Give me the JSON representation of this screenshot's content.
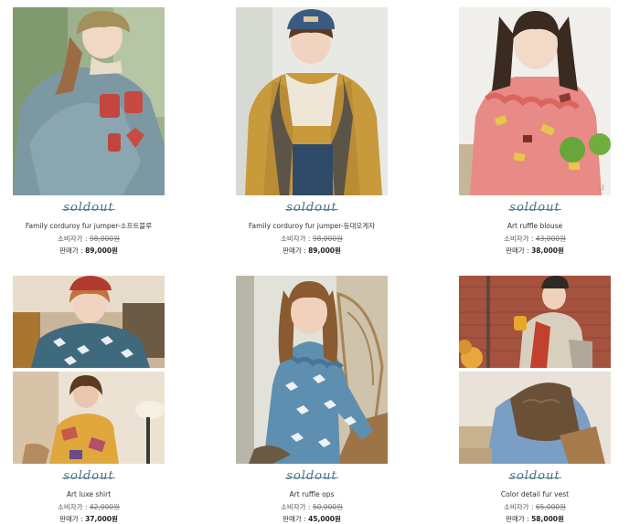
{
  "soldout_label": "soldout",
  "consumer_label": "소비자가 :",
  "sale_label": "판매가 :",
  "products": [
    {
      "name": "Family corduroy fur jumper-소프트블루",
      "original_price": "98,000원",
      "sale_price": "89,000원"
    },
    {
      "name": "Family corduroy fur jumper-등대오게자",
      "original_price": "98,000원",
      "sale_price": "89,000원"
    },
    {
      "name": "Art ruffle blouse",
      "original_price": "43,000원",
      "sale_price": "38,000원"
    },
    {
      "name": "Art luxe shirt",
      "original_price": "42,000원",
      "sale_price": "37,000원"
    },
    {
      "name": "Art ruffle ops",
      "original_price": "50,000원",
      "sale_price": "45,000원"
    },
    {
      "name": "Color detail fur vest",
      "original_price": "65,000원",
      "sale_price": "58,000원"
    }
  ]
}
